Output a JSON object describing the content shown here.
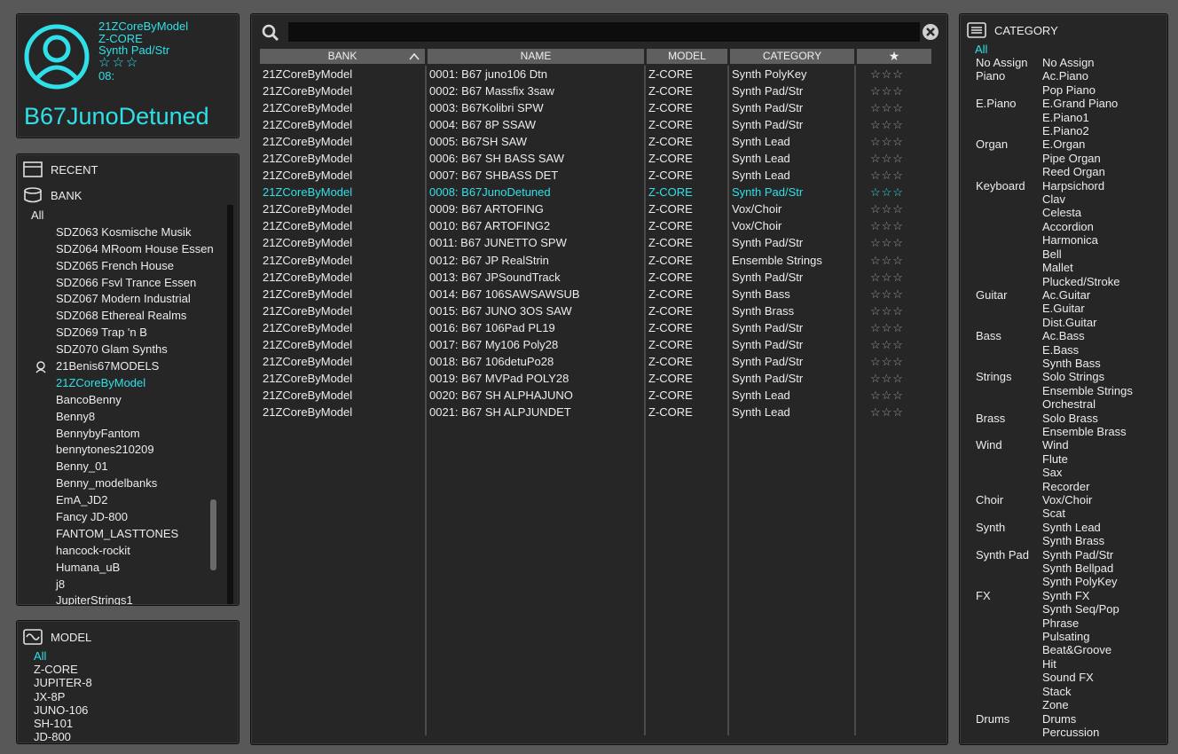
{
  "info": {
    "bank": "21ZCoreByModel",
    "model": "Z-CORE",
    "category": "Synth Pad/Str",
    "stars": "☆☆☆",
    "number": "08:",
    "tone_name": "B67JunoDetuned"
  },
  "recent_label": "RECENT",
  "bank_label": "BANK",
  "bank_list": [
    {
      "label": "All",
      "type": "all"
    },
    {
      "label": "SDZ063 Kosmische Musik"
    },
    {
      "label": "SDZ064 MRoom House Essen"
    },
    {
      "label": "SDZ065 French House"
    },
    {
      "label": "SDZ066 Fsvl Trance Essen"
    },
    {
      "label": "SDZ067 Modern Industrial"
    },
    {
      "label": "SDZ068 Ethereal Realms"
    },
    {
      "label": "SDZ069 Trap 'n B"
    },
    {
      "label": "SDZ070 Glam Synths"
    },
    {
      "label": "21Benis67MODELS",
      "icon": "user-icon"
    },
    {
      "label": "21ZCoreByModel",
      "selected": true
    },
    {
      "label": "BancoBenny"
    },
    {
      "label": "Benny8"
    },
    {
      "label": "BennybyFantom"
    },
    {
      "label": "bennytones210209"
    },
    {
      "label": "Benny_01"
    },
    {
      "label": "Benny_modelbanks"
    },
    {
      "label": "EmA_JD2"
    },
    {
      "label": "Fancy JD-800"
    },
    {
      "label": "FANTOM_LASTTONES"
    },
    {
      "label": "hancock-rockit"
    },
    {
      "label": "Humana_uB"
    },
    {
      "label": "j8"
    },
    {
      "label": "JupiterStrings1"
    }
  ],
  "model_label": "MODEL",
  "model_list": [
    {
      "label": "All",
      "selected": true
    },
    {
      "label": "Z-CORE"
    },
    {
      "label": "JUPITER-8"
    },
    {
      "label": "JX-8P"
    },
    {
      "label": "JUNO-106"
    },
    {
      "label": "SH-101"
    },
    {
      "label": "JD-800"
    }
  ],
  "search": {
    "value": ""
  },
  "columns": {
    "bank": "BANK",
    "name": "NAME",
    "model": "MODEL",
    "category": "CATEGORY",
    "star": "★"
  },
  "tones": [
    {
      "bank": "21ZCoreByModel",
      "name": "0001: B67 juno106 Dtn",
      "model": "Z-CORE",
      "category": "Synth PolyKey",
      "stars": "☆☆☆"
    },
    {
      "bank": "21ZCoreByModel",
      "name": "0002: B67 Massfix 3saw",
      "model": "Z-CORE",
      "category": "Synth Pad/Str",
      "stars": "☆☆☆"
    },
    {
      "bank": "21ZCoreByModel",
      "name": "0003: B67Kolibri  SPW",
      "model": "Z-CORE",
      "category": "Synth Pad/Str",
      "stars": "☆☆☆"
    },
    {
      "bank": "21ZCoreByModel",
      "name": "0004: B67 8P SSAW",
      "model": "Z-CORE",
      "category": "Synth Pad/Str",
      "stars": "☆☆☆"
    },
    {
      "bank": "21ZCoreByModel",
      "name": "0005: B67SH SAW",
      "model": "Z-CORE",
      "category": "Synth Lead",
      "stars": "☆☆☆"
    },
    {
      "bank": "21ZCoreByModel",
      "name": "0006: B67 SH BASS SAW",
      "model": "Z-CORE",
      "category": "Synth Lead",
      "stars": "☆☆☆"
    },
    {
      "bank": "21ZCoreByModel",
      "name": "0007: B67 SHBASS DET",
      "model": "Z-CORE",
      "category": "Synth Lead",
      "stars": "☆☆☆"
    },
    {
      "bank": "21ZCoreByModel",
      "name": "0008: B67JunoDetuned",
      "model": "Z-CORE",
      "category": "Synth Pad/Str",
      "stars": "☆☆☆",
      "selected": true
    },
    {
      "bank": "21ZCoreByModel",
      "name": "0009: B67 ARTOFING",
      "model": "Z-CORE",
      "category": "Vox/Choir",
      "stars": "☆☆☆"
    },
    {
      "bank": "21ZCoreByModel",
      "name": "0010: B67 ARTOFING2",
      "model": "Z-CORE",
      "category": "Vox/Choir",
      "stars": "☆☆☆"
    },
    {
      "bank": "21ZCoreByModel",
      "name": "0011: B67 JUNETTO  SPW",
      "model": "Z-CORE",
      "category": "Synth Pad/Str",
      "stars": "☆☆☆"
    },
    {
      "bank": "21ZCoreByModel",
      "name": "0012: B67 JP RealStrin",
      "model": "Z-CORE",
      "category": "Ensemble Strings",
      "stars": "☆☆☆"
    },
    {
      "bank": "21ZCoreByModel",
      "name": "0013: B67 JPSoundTrack",
      "model": "Z-CORE",
      "category": "Synth Pad/Str",
      "stars": "☆☆☆"
    },
    {
      "bank": "21ZCoreByModel",
      "name": "0014: B67 106SAWSAWSUB",
      "model": "Z-CORE",
      "category": "Synth Bass",
      "stars": "☆☆☆"
    },
    {
      "bank": "21ZCoreByModel",
      "name": "0015: B67 JUNO 3OS SAW",
      "model": "Z-CORE",
      "category": "Synth Brass",
      "stars": "☆☆☆"
    },
    {
      "bank": "21ZCoreByModel",
      "name": "0016: B67 106Pad  PL19",
      "model": "Z-CORE",
      "category": "Synth Pad/Str",
      "stars": "☆☆☆"
    },
    {
      "bank": "21ZCoreByModel",
      "name": "0017: B67 My106 Poly28",
      "model": "Z-CORE",
      "category": "Synth Pad/Str",
      "stars": "☆☆☆"
    },
    {
      "bank": "21ZCoreByModel",
      "name": "0018: B67 106detuPo28",
      "model": "Z-CORE",
      "category": "Synth Pad/Str",
      "stars": "☆☆☆"
    },
    {
      "bank": "21ZCoreByModel",
      "name": "0019: B67 MVPad POLY28",
      "model": "Z-CORE",
      "category": "Synth Pad/Str",
      "stars": "☆☆☆"
    },
    {
      "bank": "21ZCoreByModel",
      "name": "0020: B67 SH ALPHAJUNO",
      "model": "Z-CORE",
      "category": "Synth Lead",
      "stars": "☆☆☆"
    },
    {
      "bank": "21ZCoreByModel",
      "name": "0021: B67 SH ALPJUNDET",
      "model": "Z-CORE",
      "category": "Synth Lead",
      "stars": "☆☆☆"
    }
  ],
  "category_label": "CATEGORY",
  "category_all": "All",
  "categories": [
    [
      "No Assign",
      "No Assign"
    ],
    [
      "Piano",
      "Ac.Piano"
    ],
    [
      "",
      "Pop Piano"
    ],
    [
      "E.Piano",
      "E.Grand Piano"
    ],
    [
      "",
      "E.Piano1"
    ],
    [
      "",
      "E.Piano2"
    ],
    [
      "Organ",
      "E.Organ"
    ],
    [
      "",
      "Pipe Organ"
    ],
    [
      "",
      "Reed Organ"
    ],
    [
      "Keyboard",
      "Harpsichord"
    ],
    [
      "",
      "Clav"
    ],
    [
      "",
      "Celesta"
    ],
    [
      "",
      "Accordion"
    ],
    [
      "",
      "Harmonica"
    ],
    [
      "",
      "Bell"
    ],
    [
      "",
      "Mallet"
    ],
    [
      "",
      "Plucked/Stroke"
    ],
    [
      "Guitar",
      "Ac.Guitar"
    ],
    [
      "",
      "E.Guitar"
    ],
    [
      "",
      "Dist.Guitar"
    ],
    [
      "Bass",
      "Ac.Bass"
    ],
    [
      "",
      "E.Bass"
    ],
    [
      "",
      "Synth Bass"
    ],
    [
      "Strings",
      "Solo Strings"
    ],
    [
      "",
      "Ensemble Strings"
    ],
    [
      "",
      "Orchestral"
    ],
    [
      "Brass",
      "Solo Brass"
    ],
    [
      "",
      "Ensemble Brass"
    ],
    [
      "Wind",
      "Wind"
    ],
    [
      "",
      "Flute"
    ],
    [
      "",
      "Sax"
    ],
    [
      "",
      "Recorder"
    ],
    [
      "Choir",
      "Vox/Choir"
    ],
    [
      "",
      "Scat"
    ],
    [
      "Synth",
      "Synth Lead"
    ],
    [
      "",
      "Synth Brass"
    ],
    [
      "Synth Pad",
      "Synth Pad/Str"
    ],
    [
      "",
      "Synth Bellpad"
    ],
    [
      "",
      "Synth PolyKey"
    ],
    [
      "FX",
      "Synth FX"
    ],
    [
      "",
      "Synth Seq/Pop"
    ],
    [
      "",
      "Phrase"
    ],
    [
      "",
      "Pulsating"
    ],
    [
      "",
      "Beat&Groove"
    ],
    [
      "",
      "Hit"
    ],
    [
      "",
      "Sound FX"
    ],
    [
      "",
      "Stack"
    ],
    [
      "",
      "Zone"
    ],
    [
      "Drums",
      "Drums"
    ],
    [
      "",
      "Percussion"
    ]
  ],
  "colors": {
    "accent": "#2fe0e8",
    "panel": "#262626",
    "frame": "#585858",
    "header": "#5f5f5f"
  }
}
